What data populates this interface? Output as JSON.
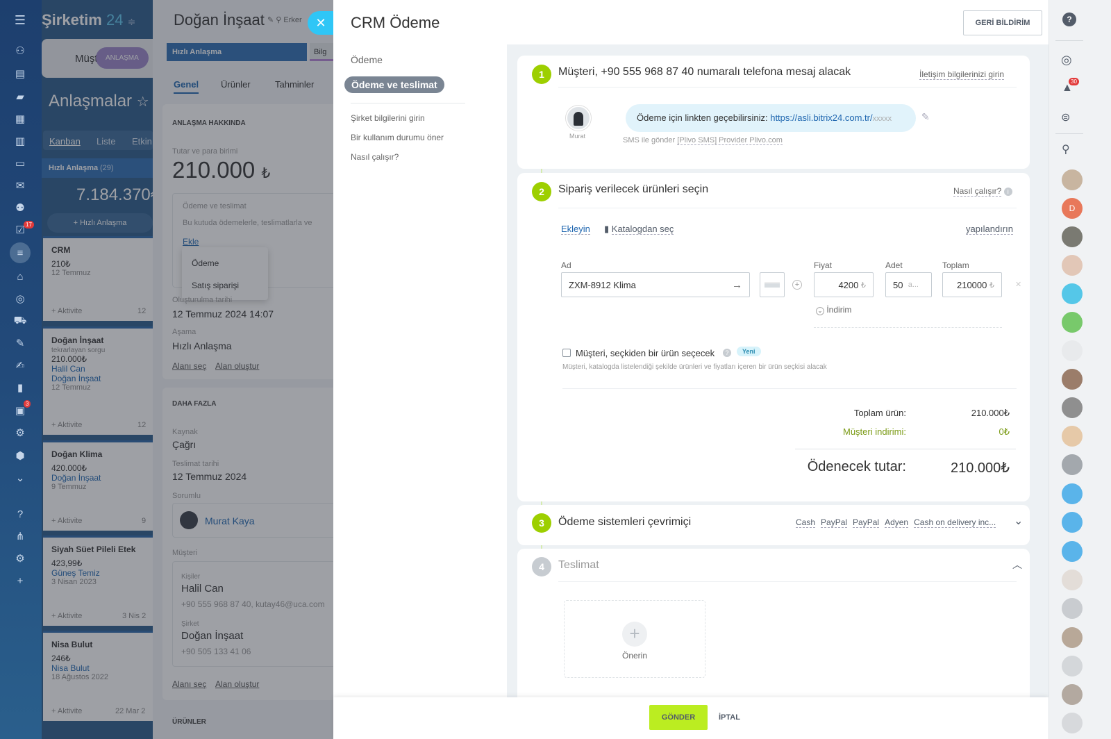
{
  "app": {
    "logo_main": "Şirketim",
    "logo_num": "24",
    "rail_badges": [
      "17",
      "3"
    ]
  },
  "kanban": {
    "tab_label": "Müşteri A",
    "stage_pill": "ANLAŞMA",
    "title": "Anlaşmalar",
    "views": [
      "Kanban",
      "Liste",
      "Etkin"
    ],
    "column_title": "Hızlı Anlaşma",
    "column_count": "(29)",
    "column_sum": "7.184.370₺",
    "add_label": "Hızlı Anlaşma",
    "cards": [
      {
        "title": "CRM",
        "amount": "210₺",
        "lines": [
          "12 Temmuz"
        ],
        "activity": "+ Aktivite",
        "date": "12"
      },
      {
        "title": "Doğan İnşaat",
        "amount": "210.000₺",
        "sub": "tekrarlayan sorgu",
        "links": [
          "Halil Can",
          "Doğan İnşaat"
        ],
        "lines": [
          "12 Temmuz"
        ],
        "activity": "+ Aktivite",
        "date": "12"
      },
      {
        "title": "Doğan Klima",
        "amount": "420.000₺",
        "links": [
          "Doğan İnşaat"
        ],
        "lines": [
          "9 Temmuz"
        ],
        "activity": "+ Aktivite",
        "date": "9"
      },
      {
        "title": "Siyah Süet Pileli Etek",
        "amount": "423,99₺",
        "links": [
          "Güneş Temiz"
        ],
        "lines": [
          "3 Nisan 2023"
        ],
        "activity": "+ Aktivite",
        "date": "3 Nis 2"
      },
      {
        "title": "Nisa Bulut",
        "amount": "246₺",
        "links": [
          "Nisa Bulut"
        ],
        "lines": [
          "18 Ağustos 2022"
        ],
        "activity": "+ Aktivite",
        "date": "22 Mar 2"
      }
    ]
  },
  "deal": {
    "title": "Doğan İnşaat",
    "owner": "Erker",
    "stage_active": "Hızlı Anlaşma",
    "stage_next": "Bilg",
    "tabs": [
      "Genel",
      "Ürünler",
      "Tahminler"
    ],
    "about_header": "ANLAŞMA HAKKINDA",
    "amount_label": "Tutar ve para birimi",
    "amount": "210.000",
    "currency": "₺",
    "payment_label": "Ödeme ve teslimat",
    "payment_desc": "Bu kutuda ödemelerle, teslimatlarla ve",
    "add_link": "Ekle",
    "popup": [
      "Ödeme",
      "Satış siparişi"
    ],
    "created_label": "Oluşturulma tarihi",
    "created": "12 Temmuz 2024 14:07",
    "stage_label": "Aşama",
    "stage": "Hızlı Anlaşma",
    "field_links": [
      "Alanı seç",
      "Alan oluştur"
    ],
    "more_header": "DAHA FAZLA",
    "source_label": "Kaynak",
    "source": "Çağrı",
    "delivery_label": "Teslimat tarihi",
    "delivery": "12 Temmuz 2024",
    "resp_label": "Sorumlu",
    "resp": "Murat Kaya",
    "client_label": "Müşteri",
    "contact_label": "Kişiler",
    "contact": "Halil Can",
    "contact_info": "+90 555 968 87 40, kutay46@uca.com",
    "company_label": "Şirket",
    "company": "Doğan İnşaat",
    "company_phone": "+90 505 133 41 06",
    "products_header": "ÜRÜNLER"
  },
  "slider": {
    "title": "CRM Ödeme",
    "feedback_btn": "GERİ BİLDİRİM",
    "nav": [
      "Ödeme",
      "Ödeme ve teslimat"
    ],
    "nav_links": [
      "Şirket bilgilerini girin",
      "Bir kullanım durumu öner",
      "Nasıl çalışır?"
    ],
    "step1": {
      "num": "1",
      "title": "Müşteri, +90 555 968 87 40 numaralı telefona mesaj alacak",
      "action": "İletişim bilgilerinizi girin",
      "avatar_name": "Murat",
      "message": "Ödeme için linkten geçebilirsiniz:",
      "link": "https://asli.bitrix24.com.tr/",
      "link_tail": "xxxxx",
      "sms_prefix": "SMS ile gönder",
      "sms_provider": "[Plivo SMS] Provider Plivo.com"
    },
    "step2": {
      "num": "2",
      "title": "Sipariş verilecek ürünleri seçin",
      "help": "Nasıl çalışır?",
      "add": "Ekleyin",
      "catalog": "Katalogdan seç",
      "configure": "yapılandırın",
      "col_name": "Ad",
      "col_price": "Fiyat",
      "col_qty": "Adet",
      "col_total": "Toplam",
      "product": "ZXM-8912 Klima",
      "price": "4200",
      "qty": "50",
      "qty_unit": "a...",
      "total": "210000",
      "cur": "₺",
      "discount": "İndirim",
      "choice_label": "Müşteri, seçkiden bir ürün seçecek",
      "new_badge": "Yeni",
      "choice_hint": "Müşteri, katalogda listelendiği şekilde ürünleri ve fiyatları içeren bir ürün seçkisi alacak",
      "sum_label": "Toplam ürün:",
      "sum_value": "210.000₺",
      "disc_label": "Müşteri indirimi:",
      "disc_value": "0₺",
      "pay_label": "Ödenecek tutar:",
      "pay_value": "210.000₺"
    },
    "step3": {
      "num": "3",
      "title": "Ödeme sistemleri çevrimiçi",
      "systems": [
        "Cash",
        "PayPal",
        "PayPal",
        "Adyen",
        "Cash on delivery inc..."
      ]
    },
    "step4": {
      "num": "4",
      "title": "Teslimat",
      "propose": "Önerin"
    },
    "send_btn": "GÖNDER",
    "cancel_btn": "İPTAL"
  },
  "right": {
    "notif_count": "30",
    "avatar_letter": "D"
  },
  "colors": {
    "accent_green": "#9dcf00",
    "link_blue": "#2067b0",
    "rail_blue": "#1d3f6e"
  }
}
